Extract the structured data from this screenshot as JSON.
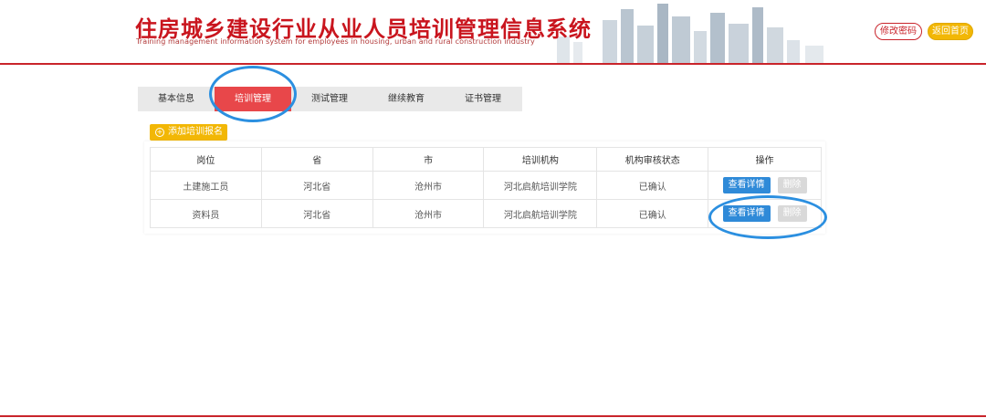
{
  "header": {
    "title": "住房城乡建设行业从业人员培训管理信息系统",
    "subtitle": "Training management information system for employees in housing, urban and rural construction industry",
    "change_password": "修改密码",
    "back_home": "返回首页"
  },
  "tabs": [
    {
      "label": "基本信息",
      "active": false
    },
    {
      "label": "培训管理",
      "active": true
    },
    {
      "label": "测试管理",
      "active": false
    },
    {
      "label": "继续教育",
      "active": false
    },
    {
      "label": "证书管理",
      "active": false
    }
  ],
  "add_button": "添加培训报名",
  "table": {
    "headers": [
      "岗位",
      "省",
      "市",
      "培训机构",
      "机构审核状态",
      "操作"
    ],
    "rows": [
      {
        "post": "土建施工员",
        "province": "河北省",
        "city": "沧州市",
        "org": "河北启航培训学院",
        "status": "已确认",
        "view": "查看详情",
        "delete": "删除"
      },
      {
        "post": "资料员",
        "province": "河北省",
        "city": "沧州市",
        "org": "河北启航培训学院",
        "status": "已确认",
        "view": "查看详情",
        "delete": "删除"
      }
    ]
  },
  "colors": {
    "brand_red": "#c9242b",
    "active_tab": "#e8474a",
    "accent_yellow": "#f2b705",
    "button_blue": "#2f8ad8",
    "annotation_blue": "#2b8fe0"
  }
}
